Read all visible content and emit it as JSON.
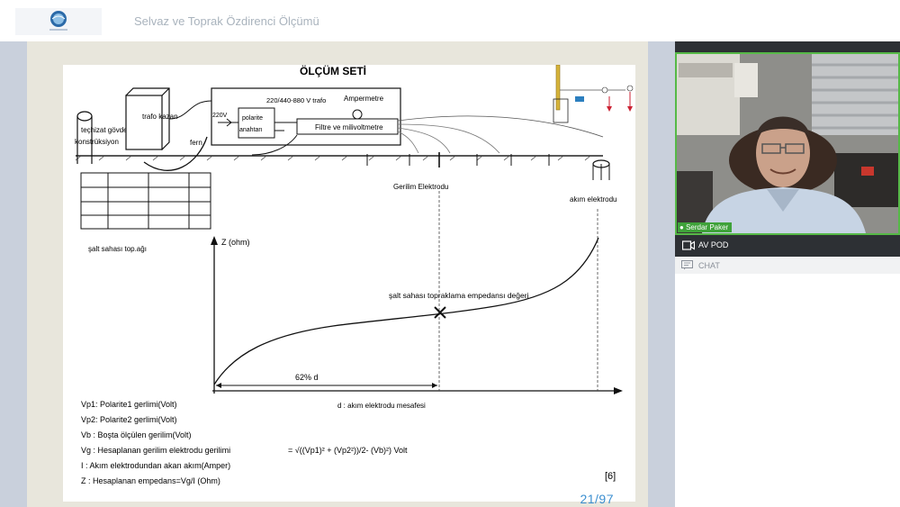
{
  "header": {
    "title": "Selvaz ve Toprak Özdirenci Ölçümü"
  },
  "slide": {
    "heading": "ÖLÇÜM SETİ",
    "labels": {
      "techizat": "teçhizat gövdesi",
      "konstruksiyon": "konstrüksiyon",
      "trafo_kazan": "trafo kazan",
      "fern": "fern",
      "voltage_trafo": "220/440-880 V trafo",
      "ampermetre": "Ampermetre",
      "v220": "220V",
      "polarite": "polarite",
      "anahtar": "anahtarı",
      "filtre": "Filtre ve milivoltmetre",
      "gerilim_elektrodu": "Gerilim Elektrodu",
      "akim_elektrodu": "akım elektrodu",
      "salt_sahasi": "şalt sahası top.ağı",
      "z_axis": "Z (ohm)",
      "empedans": "şalt sahası topraklama empedansı değeri",
      "percent": "62% d",
      "d_axis": "d : akım elektrodu mesafesi",
      "citation": "[6]"
    },
    "legend": [
      "Vp1: Polarite1 gerlimi(Volt)",
      "Vp2: Polarite2 gerlimi(Volt)",
      "Vb  : Boşta ölçülen gerilim(Volt)",
      "Vg  : Hesaplanan gerilim elektrodu gerilimi",
      "I    : Akım elektrodundan akan akım(Amper)",
      "Z   : Hesaplanan empedans=Vg/I (Ohm)"
    ],
    "formula": "= √((Vp1)² + (Vp2²))/2- (Vb)²) Volt",
    "page_counter": "21/97"
  },
  "video": {
    "presenter_name": "Serdar Paker"
  },
  "panel": {
    "av_label": "AV POD",
    "chat_label": "CHAT"
  },
  "colors": {
    "accent": "#3c8fd0",
    "speaker_border": "#56b947",
    "dark_bar": "#2d3034"
  }
}
